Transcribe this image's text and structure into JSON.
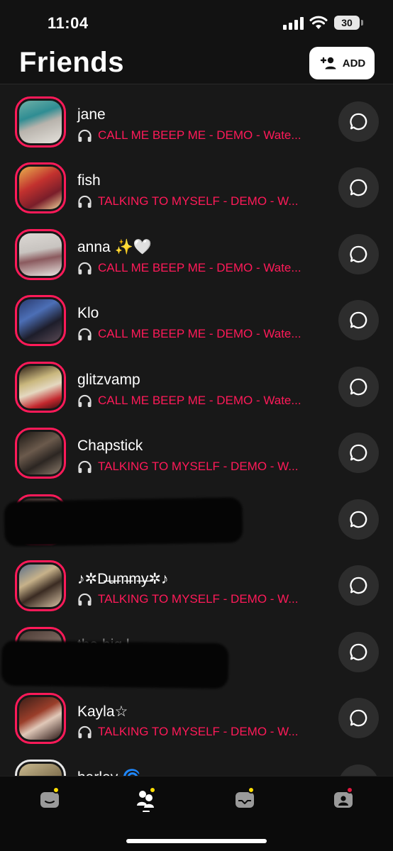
{
  "status_bar": {
    "time": "11:04",
    "battery": "30"
  },
  "header": {
    "title": "Friends",
    "add_label": "ADD"
  },
  "friends": [
    {
      "name": "jane",
      "track": "CALL ME BEEP ME - DEMO - Wate..."
    },
    {
      "name": "fish",
      "track": "TALKING TO MYSELF - DEMO - W..."
    },
    {
      "name": "anna ✨🤍",
      "track": "CALL ME BEEP ME - DEMO - Wate..."
    },
    {
      "name": "Klo",
      "track": "CALL ME BEEP ME - DEMO - Wate..."
    },
    {
      "name": "glitzvamp",
      "track": "CALL ME BEEP ME - DEMO - Wate..."
    },
    {
      "name": "Chapstick",
      "track": "TALKING TO MYSELF - DEMO - W..."
    },
    {
      "name": "",
      "track": "",
      "redacted": true
    },
    {
      "name": "♪✲D̶u̶m̶m̶y̶✲♪",
      "track": "TALKING TO MYSELF - DEMO - W..."
    },
    {
      "name": "tha big l",
      "track": "",
      "redacted": true
    },
    {
      "name": "Kayla☆",
      "track": "TALKING TO MYSELF - DEMO - W..."
    },
    {
      "name": "harley 🌀",
      "track": ""
    }
  ],
  "tabs": [
    {
      "icon": "profile-card-icon",
      "badge": true
    },
    {
      "icon": "friends-icon",
      "badge": true,
      "active": true
    },
    {
      "icon": "inbox-tray-icon",
      "badge": true
    },
    {
      "icon": "user-badge-icon",
      "badge": true
    }
  ],
  "colors": {
    "accent": "#ff1a59",
    "badge": "#ffde03",
    "background": "#181818"
  }
}
